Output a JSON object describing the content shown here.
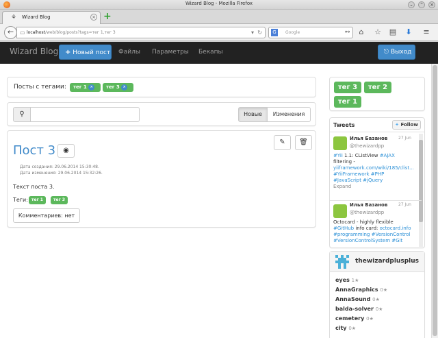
{
  "browser": {
    "window_title": "Wizard Blog - Mozilla Firefox",
    "tab_title": "Wizard Blog",
    "url_host": "localhost",
    "url_path": "/web/blog/posts?tags=тег 1,тег 3",
    "search_placeholder": "Google"
  },
  "site": {
    "brand": "Wizard Blog",
    "new_post": "Новый пост",
    "nav": [
      "Файлы",
      "Параметры",
      "Бекапы"
    ],
    "logout": "Выход"
  },
  "filter": {
    "label": "Посты с тегами:",
    "tags": [
      "тег 1",
      "тег 3"
    ],
    "remove_icon": "×"
  },
  "search": {
    "sort_new": "Новые",
    "sort_changes": "Изменения"
  },
  "post": {
    "title": "Пост 3",
    "created": "Дата создания: 29.06.2014 15:30:48.",
    "modified": "Дата изменения: 29.06.2014 15:32:26.",
    "body": "Текст поста 3.",
    "tags_label": "Теги:",
    "tags": [
      "тег 1",
      "тег 3"
    ],
    "comments": "Комментариев: нет"
  },
  "tag_cloud": [
    "тег 3",
    "тег 2",
    "тег 1"
  ],
  "tweets": {
    "title": "Tweets",
    "follow": "Follow",
    "items": [
      {
        "name": "Илья Базанов",
        "handle": "@thewizardpp",
        "date": "27 Jun",
        "line1_tag": "#Yii",
        "line1_text": " 1.1: CListView ",
        "line1_tag2": "#AJAX",
        "line2": "filtering -",
        "line3": "yiiframework.com/wiki/185/clist...",
        "line4": " #YiiFramework #PHP",
        "line5": "#JavaScript #jQuery",
        "expand": "Expand"
      },
      {
        "name": "Илья Базанов",
        "handle": "@thewizardpp",
        "date": "27 Jun",
        "line1": "Octocard - highly flexible",
        "line2_tag": "#GitHub",
        "line2_text": " info card: ",
        "line2_link": "octocard.info",
        "line3": "#programming #VersionControl",
        "line4": "#VersionControlSystem #Git"
      }
    ]
  },
  "github": {
    "user": "thewizardplusplus",
    "repos": [
      {
        "name": "eyes",
        "count": "1"
      },
      {
        "name": "AnnaGraphics",
        "count": "0"
      },
      {
        "name": "AnnaSound",
        "count": "0"
      },
      {
        "name": "balda-solver",
        "count": "0"
      },
      {
        "name": "cemetery",
        "count": "0"
      },
      {
        "name": "city",
        "count": "0"
      }
    ],
    "star": "★"
  },
  "colors": {
    "primary": "#428bca",
    "success": "#5cb85c",
    "navbar": "#222222",
    "link": "#428bca"
  }
}
